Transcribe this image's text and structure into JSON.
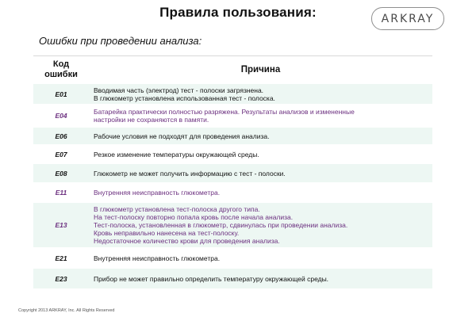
{
  "title": "Правила пользования:",
  "logo": {
    "text": "ARKRAY"
  },
  "subtitle": "Ошибки при проведении анализа:",
  "table": {
    "header": {
      "code_line1": "Код",
      "code_line2": "ошибки",
      "reason": "Причина"
    },
    "rows": [
      {
        "code": "E01",
        "lines": [
          "Вводимая часть (электрод) тест - полоски загрязнена.",
          "В глюкометр установлена использованная тест - полоска."
        ]
      },
      {
        "code": "E04",
        "lines": [
          "Батарейка практически полностью разряжена. Результаты анализов и измененные",
          "настройки не сохраняются в памяти."
        ]
      },
      {
        "code": "E06",
        "lines": [
          "Рабочие условия не подходят для проведения анализа."
        ]
      },
      {
        "code": "E07",
        "lines": [
          "Резкое изменение температуры окружающей среды."
        ]
      },
      {
        "code": "E08",
        "lines": [
          "Глюкометр не может получить информацию с тест - полоски."
        ]
      },
      {
        "code": "E11",
        "lines": [
          "Внутренняя неисправность глюкометра."
        ]
      },
      {
        "code": "E13",
        "lines": [
          "В глюкометр установлена тест-полоска другого типа.",
          "На тест-полоску повторно попала кровь после начала анализа.",
          "Тест-полоска, установленная в глюкометр, сдвинулась при  проведении анализа.",
          "Кровь неправильно нанесена на тест-полоску.",
          "Недостаточное количество крови для проведения анализа."
        ]
      },
      {
        "code": "E21",
        "lines": [
          "Внутренняя неисправность глюкометра."
        ]
      },
      {
        "code": "E23",
        "lines": [
          "Прибор не может правильно определить температуру окружающей среды."
        ]
      }
    ]
  },
  "copyright": "Copyright 2013 ARKRAY, Inc. All Rights Reserved",
  "colors": {
    "row_tint": "#edf7f3",
    "purple_text": "#6b2f7f"
  }
}
